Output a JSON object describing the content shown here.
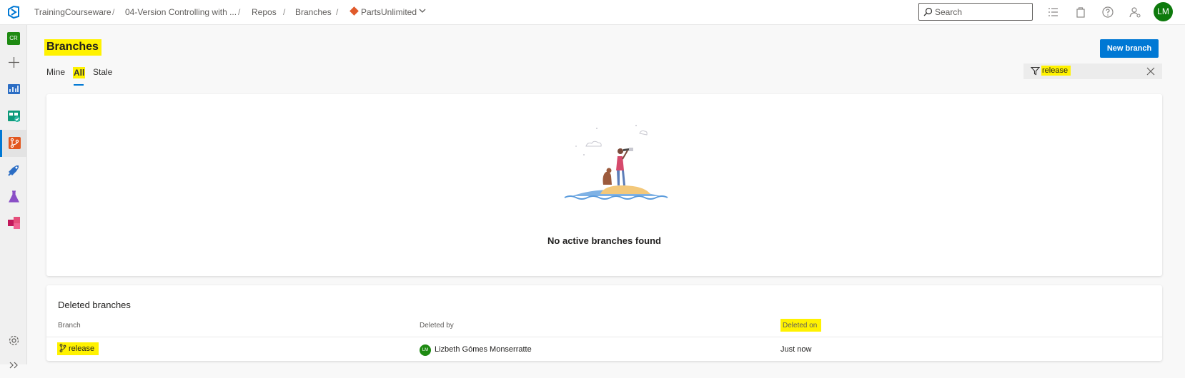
{
  "header": {
    "breadcrumbs": [
      "TrainingCourseware",
      "04-Version Controlling with ...",
      "Repos",
      "Branches",
      "PartsUnlimited"
    ],
    "search_placeholder": "Search",
    "user_initials": "LM"
  },
  "rail": {
    "project_initials": "CR",
    "items": [
      "overview-icon",
      "boards-icon",
      "repos-icon",
      "pipelines-icon",
      "test-plans-icon",
      "artifacts-icon"
    ]
  },
  "page": {
    "title": "Branches",
    "tabs": [
      "Mine",
      "All",
      "Stale"
    ],
    "active_tab": "All",
    "new_branch_label": "New branch",
    "filter_value": "release"
  },
  "empty_state": {
    "message": "No active branches found"
  },
  "deleted_branches": {
    "title": "Deleted branches",
    "columns": [
      "Branch",
      "Deleted by",
      "Deleted on"
    ],
    "rows": [
      {
        "branch": "release",
        "deleted_by_initials": "LM",
        "deleted_by": "Lizbeth Gómes Monserratte",
        "deleted_on": "Just now"
      }
    ]
  },
  "colors": {
    "accent": "#0078d4",
    "highlight": "#fff200",
    "avatar": "#0e7a0d"
  }
}
